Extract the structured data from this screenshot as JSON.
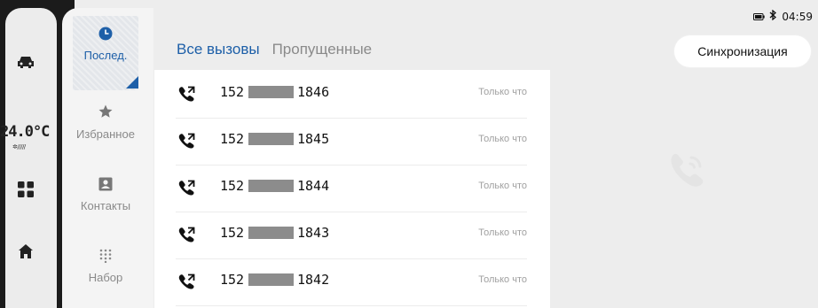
{
  "status_bar": {
    "time": "04:59",
    "battery_icon": "battery-icon",
    "bluetooth_icon": "bluetooth-icon"
  },
  "rail": {
    "temperature": "24.0°C",
    "fan_indicator": "✲/////",
    "icons": [
      "car-icon",
      "apps-icon",
      "home-icon"
    ]
  },
  "categories": [
    {
      "label": "Послед.",
      "icon": "recent-clock-icon",
      "active": true
    },
    {
      "label": "Избранное",
      "icon": "star-icon",
      "active": false
    },
    {
      "label": "Контакты",
      "icon": "contact-card-icon",
      "active": false
    },
    {
      "label": "Набор",
      "icon": "dialpad-icon",
      "active": false
    }
  ],
  "tabs": {
    "all_calls": "Все вызовы",
    "missed": "Пропущенные"
  },
  "sync_label": "Синхронизация",
  "calls": [
    {
      "prefix": "152",
      "suffix": "1846",
      "time": "Только что"
    },
    {
      "prefix": "152",
      "suffix": "1845",
      "time": "Только что"
    },
    {
      "prefix": "152",
      "suffix": "1844",
      "time": "Только что"
    },
    {
      "prefix": "152",
      "suffix": "1843",
      "time": "Только что"
    },
    {
      "prefix": "152",
      "suffix": "1842",
      "time": "Только что"
    }
  ],
  "colors": {
    "accent": "#1d5fa8",
    "frame": "#1b1b1b",
    "background": "#ededed"
  },
  "detail_placeholder_icon": "phone-ringing-icon"
}
